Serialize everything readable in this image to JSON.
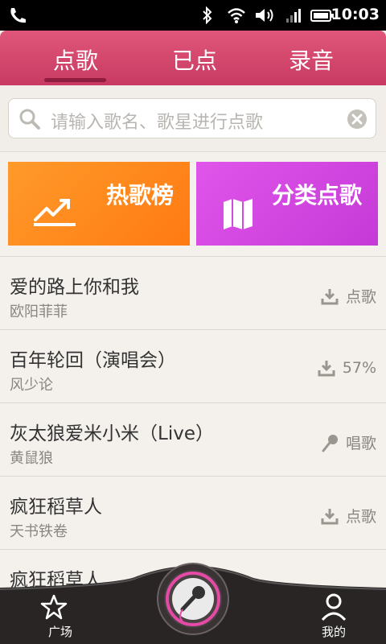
{
  "status": {
    "time": "10:03"
  },
  "tabs": [
    {
      "label": "点歌",
      "active": true
    },
    {
      "label": "已点",
      "active": false
    },
    {
      "label": "录音",
      "active": false
    }
  ],
  "search": {
    "placeholder": "请输入歌名、歌星进行点歌"
  },
  "tiles": [
    {
      "label": "热歌榜",
      "icon": "trending-chart-icon"
    },
    {
      "label": "分类点歌",
      "icon": "map-icon"
    }
  ],
  "songs": [
    {
      "title": "爱的路上你和我",
      "artist": "欧阳菲菲",
      "action": "点歌",
      "icon": "download-icon"
    },
    {
      "title": "百年轮回（演唱会）",
      "artist": "风少论",
      "action": "57%",
      "icon": "download-icon"
    },
    {
      "title": "灰太狼爱米小米（Live）",
      "artist": "黄鼠狼",
      "action": "唱歌",
      "icon": "microphone-icon"
    },
    {
      "title": "疯狂稻草人",
      "artist": "天书铁卷",
      "action": "点歌",
      "icon": "download-icon"
    },
    {
      "title": "疯狂稻草人",
      "artist": "",
      "action": "",
      "icon": "download-icon"
    }
  ],
  "bottom_nav": {
    "left_label": "广场",
    "right_label": "我的"
  },
  "colors": {
    "header": "#d84a6f",
    "hot_tile": "#ff8a1c",
    "category_tile": "#d24ae0"
  }
}
